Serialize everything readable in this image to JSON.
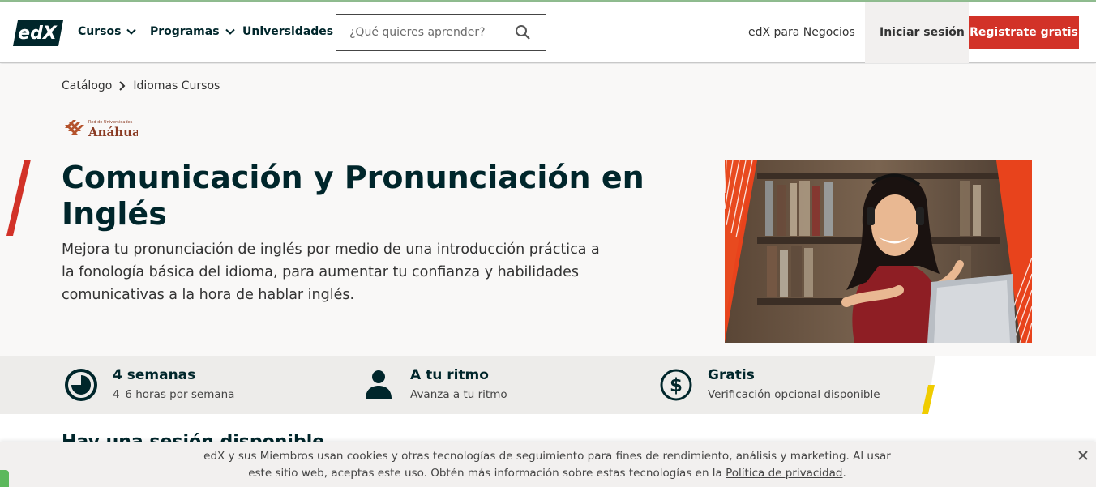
{
  "header": {
    "logo_text": "edX",
    "nav": [
      {
        "label": "Cursos"
      },
      {
        "label": "Programas"
      },
      {
        "label": "Universidades"
      }
    ],
    "search_placeholder": "¿Qué quieres aprender?",
    "business_link": "edX para Negocios",
    "signin_label": "Iniciar sesión",
    "register_label": "Registrate gratis"
  },
  "breadcrumb": {
    "items": [
      "Catálogo",
      "Idiomas Cursos"
    ]
  },
  "partner": {
    "logo_text_small": "Red de Universidades",
    "logo_text_large": "Anáhuac"
  },
  "course": {
    "title": "Comunicación y Pronunciación en Inglés",
    "subtitle": "Mejora tu pronunciación de inglés por medio de una introducción práctica a la fonología básica del idioma, para aumentar tu confianza y habilidades comunicativas a la hora de hablar inglés."
  },
  "stats": [
    {
      "icon": "clock-icon",
      "title": "4 semanas",
      "subtitle": "4–6 horas por semana"
    },
    {
      "icon": "person-icon",
      "title": "A tu ritmo",
      "subtitle": "Avanza a tu ritmo"
    },
    {
      "icon": "dollar-icon",
      "title": "Gratis",
      "subtitle": "Verificación opcional disponible"
    }
  ],
  "below": {
    "partial_heading": "Hay una sesión disponible"
  },
  "cookie": {
    "text_before": "edX y sus Miembros usan cookies y otras tecnologías de seguimiento para fines de rendimiento, análisis y marketing. Al usar este sitio web, aceptas este uso. Obtén más información sobre estas tecnologías en la ",
    "link": "Política de privacidad",
    "text_after": "."
  },
  "colors": {
    "brand_dark": "#00262b",
    "accent_red": "#d23228",
    "accent_yellow": "#f0cc00"
  }
}
